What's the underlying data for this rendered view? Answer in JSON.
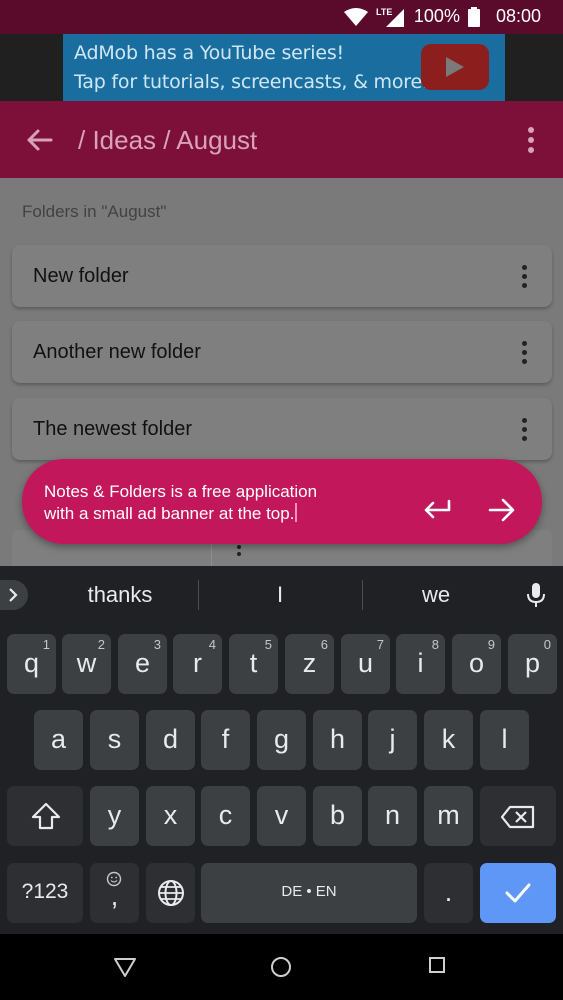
{
  "status_bar": {
    "network": "LTE",
    "battery": "100%",
    "time": "08:00"
  },
  "ad": {
    "line1": "AdMob has a YouTube series!",
    "line2": "Tap for tutorials, screencasts, & more."
  },
  "toolbar": {
    "title": "/ Ideas / August",
    "back_icon": "arrow-left-icon",
    "menu_icon": "more-vert-icon"
  },
  "content": {
    "section_label": "Folders in \"August\"",
    "folders": [
      "New folder",
      "Another new folder",
      "The newest folder"
    ]
  },
  "editor": {
    "text_line1": "Notes & Folders is a free application",
    "text_line2": "with a small ad banner at the top.",
    "accent_color": "#c2185b"
  },
  "keyboard": {
    "suggestions": [
      "thanks",
      "I",
      "we"
    ],
    "row1": [
      {
        "k": "q",
        "h": "1"
      },
      {
        "k": "w",
        "h": "2"
      },
      {
        "k": "e",
        "h": "3"
      },
      {
        "k": "r",
        "h": "4"
      },
      {
        "k": "t",
        "h": "5"
      },
      {
        "k": "z",
        "h": "6"
      },
      {
        "k": "u",
        "h": "7"
      },
      {
        "k": "i",
        "h": "8"
      },
      {
        "k": "o",
        "h": "9"
      },
      {
        "k": "p",
        "h": "0"
      }
    ],
    "row2": [
      "a",
      "s",
      "d",
      "f",
      "g",
      "h",
      "j",
      "k",
      "l"
    ],
    "row3": [
      "y",
      "x",
      "c",
      "v",
      "b",
      "n",
      "m"
    ],
    "symbols_key": "?123",
    "comma_key": ",",
    "space_key": "DE • EN",
    "period_key": ".",
    "enter_color": "#5e97f6"
  }
}
